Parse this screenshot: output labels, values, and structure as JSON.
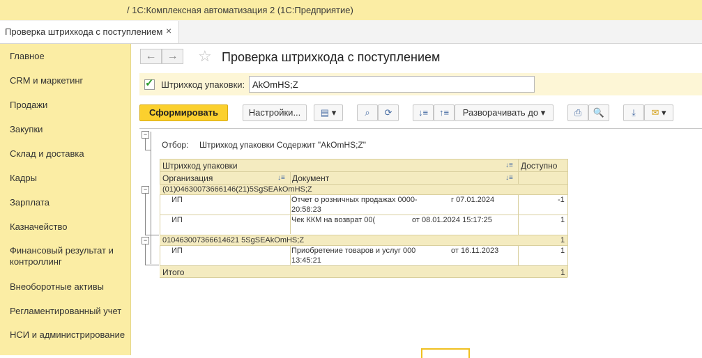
{
  "window": {
    "title": "/ 1С:Комплексная автоматизация 2  (1С:Предприятие)"
  },
  "tab": {
    "label": "Проверка штрихкода с поступлением",
    "close": "×"
  },
  "sidebar": {
    "items": [
      "Главное",
      "CRM и маркетинг",
      "Продажи",
      "Закупки",
      "Склад и доставка",
      "Кадры",
      "Зарплата",
      "Казначейство",
      "Финансовый результат и контроллинг",
      "Внеоборотные активы",
      "Регламентированный учет",
      "НСИ и администрирование"
    ]
  },
  "page": {
    "title": "Проверка штрихкода с поступлением",
    "back": "←",
    "forward": "→",
    "star": "☆"
  },
  "filter": {
    "checked": true,
    "label": "Штрихкод упаковки:",
    "value": "AkOmHS;Z"
  },
  "toolbar": {
    "generate": "Сформировать",
    "settings": "Настройки...",
    "expand": "Разворачивать до",
    "caret": "▾"
  },
  "report": {
    "selection_label": "Отбор:",
    "selection_value": "Штрихкод упаковки Содержит \"AkOmHS;Z\"",
    "headers": {
      "barcode": "Штрихкод упаковки",
      "available": "Доступно",
      "org": "Организация",
      "doc": "Документ"
    },
    "groups": [
      {
        "barcode": "(01)04630073666146(21)5SgSEAkOmHS;Z",
        "total": "",
        "rows": [
          {
            "org": "ИП",
            "doc1": "Отчет о розничных продажах 0000-",
            "doc1b": "г 07.01.2024",
            "doc2": "20:58:23",
            "qty": "-1"
          },
          {
            "org": "ИП",
            "doc1": "Чек ККМ на возврат 00(",
            "doc1b": "от 08.01.2024 15:17:25",
            "doc2": "",
            "qty": "1"
          }
        ]
      },
      {
        "barcode": "010463007366614621 5SgSEAkOmHS;Z",
        "total": "1",
        "rows": [
          {
            "org": "ИП",
            "doc1": "Приобретение товаров и услуг 000",
            "doc1b": "от 16.11.2023",
            "doc2": "13:45:21",
            "qty": "1"
          }
        ]
      }
    ],
    "total_label": "Итого",
    "total_value": "1"
  }
}
